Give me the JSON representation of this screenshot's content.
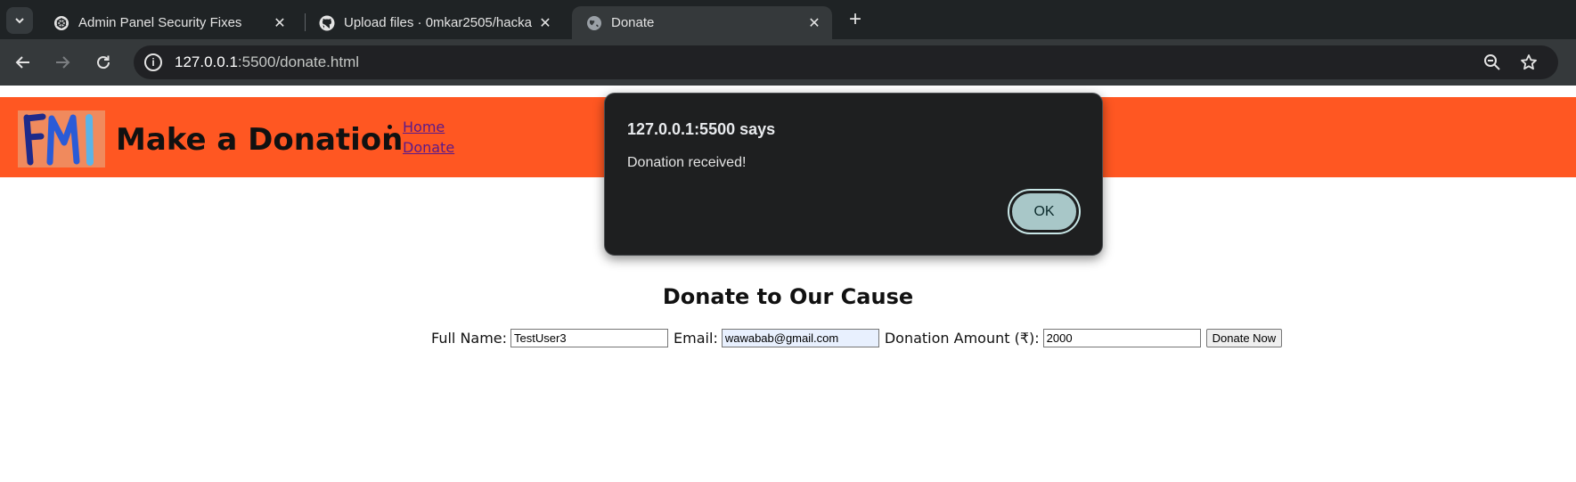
{
  "browser": {
    "tabs": [
      {
        "title": "Admin Panel Security Fixes",
        "icon": "openai-icon",
        "active": false
      },
      {
        "title": "Upload files · 0mkar2505/hacka",
        "icon": "github-icon",
        "active": false
      },
      {
        "title": "Donate",
        "icon": "globe-icon",
        "active": true
      }
    ],
    "url_host": "127.0.0.1",
    "url_path": ":5500/donate.html"
  },
  "site": {
    "logo_text": "FMI",
    "title": "Make a Donation",
    "nav": [
      "Home",
      "Donate"
    ],
    "header_color": "#ff5722"
  },
  "main": {
    "heading": "Donate to Our Cause",
    "form": {
      "name_label": "Full Name:",
      "name_value": "TestUser3",
      "email_label": "Email:",
      "email_value": "wawabab@gmail.com",
      "amount_label": "Donation Amount (₹):",
      "amount_value": "2000",
      "submit_label": "Donate Now"
    }
  },
  "dialog": {
    "title": "127.0.0.1:5500 says",
    "message": "Donation received!",
    "ok_label": "OK"
  }
}
